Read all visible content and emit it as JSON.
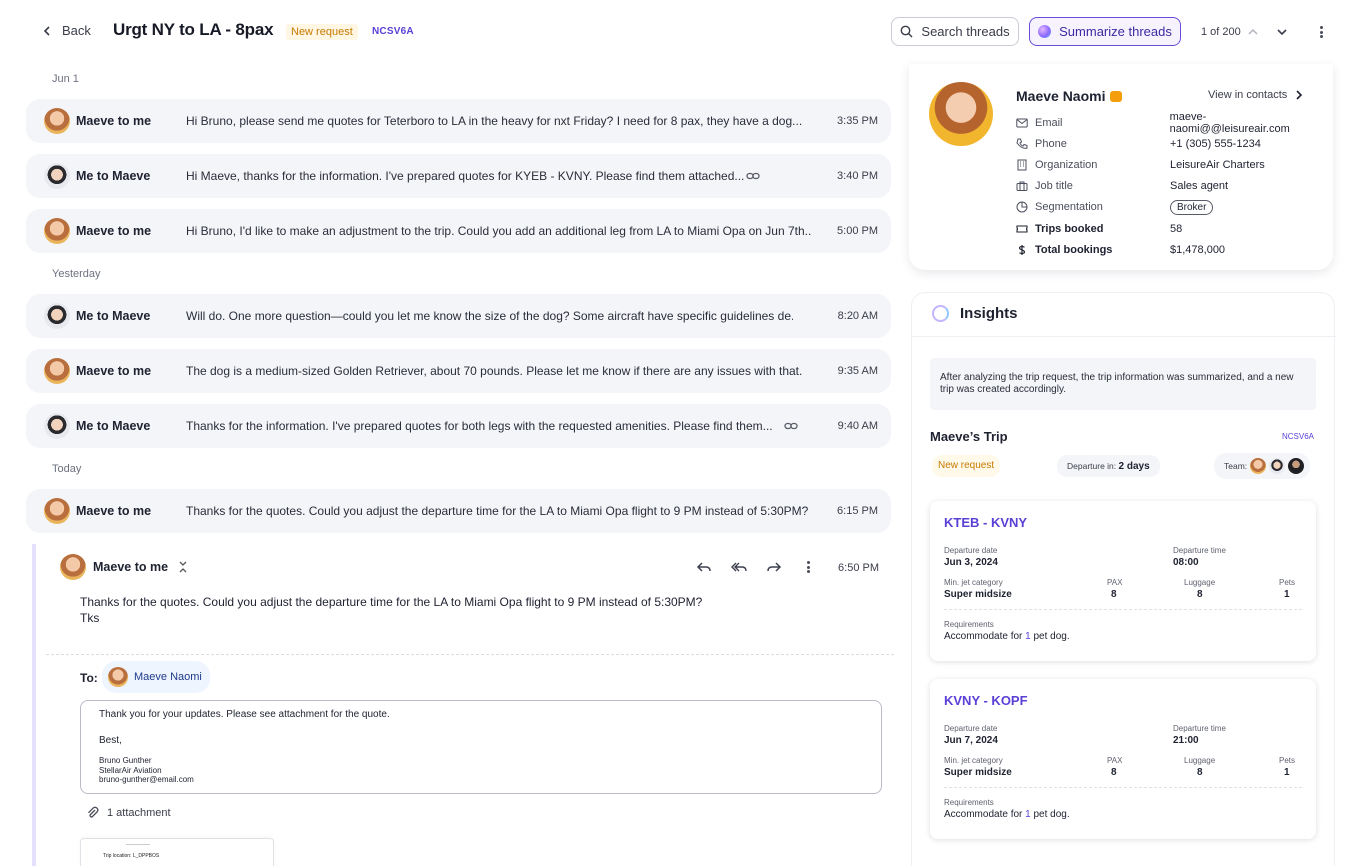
{
  "header": {
    "back_label": "Back",
    "title": "Urgt NY to LA - 8pax",
    "status_tag": "New request",
    "code": "NCSV6A",
    "search_label": "Search threads",
    "summarize_label": "Summarize threads",
    "pager": "1 of 200"
  },
  "thread": {
    "days": [
      "Jun 1",
      "Yesterday",
      "Today"
    ],
    "messages": [
      {
        "who": "Maeve to me",
        "snippet": "Hi Bruno, please send me quotes for Teterboro to LA in the heavy for nxt Friday? I need for 8 pax, they have a dog...",
        "time": "3:35 PM"
      },
      {
        "who": "Me to Maeve",
        "snippet": "Hi Maeve, thanks for the information. I've prepared quotes for KYEB - KVNY. Please find them attached...",
        "time": "3:40 PM"
      },
      {
        "who": "Maeve to me",
        "snippet": "Hi Bruno, I'd like to make an adjustment to the trip. Could you add an additional leg from LA to Miami Opa on Jun 7th...",
        "time": "5:00 PM"
      },
      {
        "who": "Me to Maeve",
        "snippet": "Will do. One more question—could you let me know the size of the dog? Some aircraft have specific guidelines de...",
        "time": "8:20 AM"
      },
      {
        "who": "Maeve to me",
        "snippet": "The dog is a medium-sized Golden Retriever, about 70 pounds. Please let me know if there are any issues with that.",
        "time": "9:35 AM"
      },
      {
        "who": "Me to Maeve",
        "snippet": "Thanks for the information. I've prepared quotes for both legs with the requested amenities. Please find them...",
        "time": "9:40 AM"
      },
      {
        "who": "Maeve to me",
        "snippet": "Thanks for the quotes. Could you adjust the departure time for the LA to Miami Opa flight to 9 PM instead of 5:30PM?",
        "time": "6:15 PM"
      }
    ],
    "open": {
      "who": "Maeve to me",
      "time": "6:50 PM",
      "body_line1": "Thanks for the quotes. Could you adjust the departure time for the LA to Miami Opa flight to 9 PM instead of 5:30PM?",
      "body_line2": "Tks",
      "to_label": "To:",
      "to_name": "Maeve Naomi",
      "reply_line1": "Thank you for your updates. Please see attachment for the quote.",
      "reply_line2": "Best,",
      "sig_name": "Bruno Gunther",
      "sig_company": "StellarAir Aviation",
      "sig_email": "bruno-gunther@email.com",
      "attachment_label": "1 attachment",
      "thumb_text": "Trip location: L_DPPBOS"
    }
  },
  "contact": {
    "name": "Maeve Naomi",
    "view_label": "View in contacts",
    "rows": [
      {
        "label": "Email",
        "value": "maeve-naomi@@leisureair.com"
      },
      {
        "label": "Phone",
        "value": "+1 (305) 555-1234"
      },
      {
        "label": "Organization",
        "value": "LeisureAir Charters"
      },
      {
        "label": "Job title",
        "value": "Sales agent"
      },
      {
        "label": "Segmentation",
        "value": "Broker"
      },
      {
        "label": "Trips booked",
        "value": "58"
      },
      {
        "label": "Total bookings",
        "value": "$1,478,000"
      }
    ]
  },
  "insights": {
    "title": "Insights",
    "summary": "After analyzing the trip request, the trip information was summarized, and a new trip was created accordingly.",
    "trip_title": "Maeve’s Trip",
    "trip_code": "NCSV6A",
    "status": "New request",
    "departure_in_label": "Departure in:",
    "departure_in_value": "2 days",
    "team_label": "Team:",
    "legs": [
      {
        "route": "KTEB - KVNY",
        "date_label": "Departure date",
        "date": "Jun 3, 2024",
        "time_label": "Departure time",
        "time": "08:00",
        "cat_label": "Min. jet category",
        "cat": "Super midsize",
        "pax_label": "PAX",
        "pax": "8",
        "lug_label": "Luggage",
        "lug": "8",
        "pets_label": "Pets",
        "pets": "1",
        "req_label": "Requirements",
        "req_pre": "Accommodate for",
        "req_num": "1",
        "req_post": "pet dog."
      },
      {
        "route": "KVNY - KOPF",
        "date_label": "Departure date",
        "date": "Jun 7, 2024",
        "time_label": "Departure time",
        "time": "21:00",
        "cat_label": "Min. jet category",
        "cat": "Super midsize",
        "pax_label": "PAX",
        "pax": "8",
        "lug_label": "Luggage",
        "lug": "8",
        "pets_label": "Pets",
        "pets": "1",
        "req_label": "Requirements",
        "req_pre": "Accommodate for",
        "req_num": "1",
        "req_post": "pet dog."
      }
    ]
  }
}
